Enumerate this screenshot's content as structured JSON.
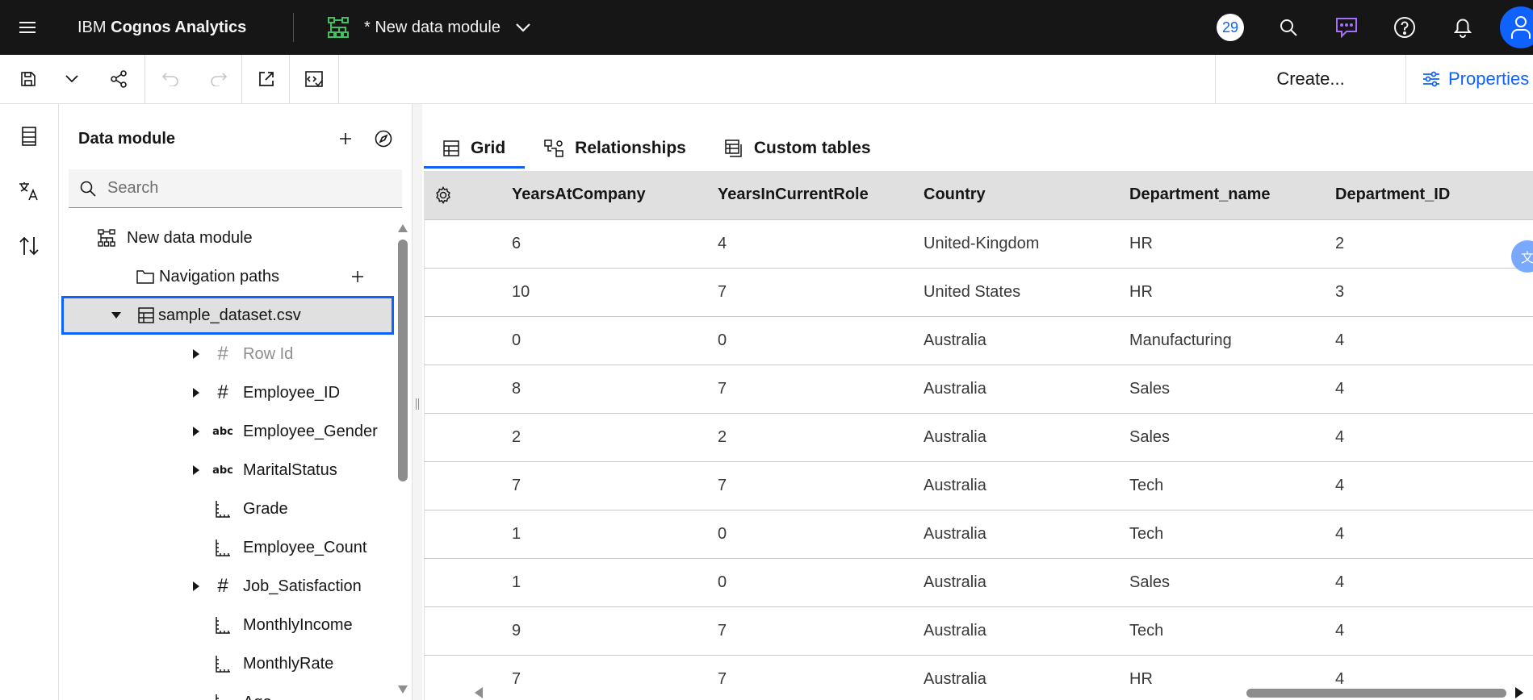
{
  "header": {
    "brand_prefix": "IBM ",
    "brand_name": "Cognos Analytics",
    "module_title": "* New data module",
    "notification_count": "29"
  },
  "toolbar": {
    "create_label": "Create...",
    "properties_label": "Properties"
  },
  "panel": {
    "title": "Data module",
    "search_placeholder": "Search",
    "tree": [
      {
        "label": "New data module",
        "icon": "data-module-icon"
      },
      {
        "label": "Navigation paths",
        "icon": "folder-icon"
      },
      {
        "label": "sample_dataset.csv",
        "icon": "table-icon",
        "selected": true
      },
      {
        "label": "Row Id",
        "icon": "hash-icon",
        "dimmed": true
      },
      {
        "label": "Employee_ID",
        "icon": "hash-icon"
      },
      {
        "label": "Employee_Gender",
        "icon": "abc-icon",
        "icon_text": "abc"
      },
      {
        "label": "MaritalStatus",
        "icon": "abc-icon",
        "icon_text": "abc"
      },
      {
        "label": "Grade",
        "icon": "measure-icon"
      },
      {
        "label": "Employee_Count",
        "icon": "measure-icon"
      },
      {
        "label": "Job_Satisfaction",
        "icon": "hash-icon"
      },
      {
        "label": "MonthlyIncome",
        "icon": "measure-icon"
      },
      {
        "label": "MonthlyRate",
        "icon": "measure-icon"
      },
      {
        "label": "Age",
        "icon": "measure-icon"
      }
    ]
  },
  "tabs": [
    {
      "label": "Grid",
      "active": true,
      "icon": "grid-icon"
    },
    {
      "label": "Relationships",
      "icon": "relationships-icon"
    },
    {
      "label": "Custom tables",
      "icon": "custom-tables-icon"
    }
  ],
  "grid": {
    "columns": [
      "YearsAtCompany",
      "YearsInCurrentRole",
      "Country",
      "Department_name",
      "Department_ID"
    ],
    "rows": [
      [
        "6",
        "4",
        "United-Kingdom",
        "HR",
        "2"
      ],
      [
        "10",
        "7",
        "United States",
        "HR",
        "3"
      ],
      [
        "0",
        "0",
        "Australia",
        "Manufacturing",
        "4"
      ],
      [
        "8",
        "7",
        "Australia",
        "Sales",
        "4"
      ],
      [
        "2",
        "2",
        "Australia",
        "Sales",
        "4"
      ],
      [
        "7",
        "7",
        "Australia",
        "Tech",
        "4"
      ],
      [
        "1",
        "0",
        "Australia",
        "Tech",
        "4"
      ],
      [
        "1",
        "0",
        "Australia",
        "Sales",
        "4"
      ],
      [
        "9",
        "7",
        "Australia",
        "Tech",
        "4"
      ],
      [
        "7",
        "7",
        "Australia",
        "HR",
        "4"
      ]
    ]
  },
  "colors": {
    "header_bg": "#161616",
    "accent": "#0f62fe",
    "table_header_bg": "#e0e0e0"
  }
}
